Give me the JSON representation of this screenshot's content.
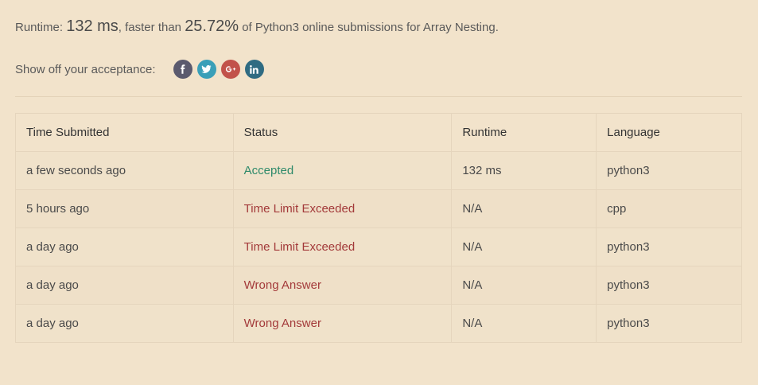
{
  "summary": {
    "runtime_prefix": "Runtime: ",
    "runtime_value": "132 ms",
    "faster_than_text": ", faster than ",
    "percentile": "25.72%",
    "suffix": " of Python3 online submissions for Array Nesting."
  },
  "share": {
    "label": "Show off your acceptance:",
    "icons": [
      {
        "name": "facebook-icon",
        "color": "#5b5a6e"
      },
      {
        "name": "twitter-icon",
        "color": "#3a9fb8"
      },
      {
        "name": "google-plus-icon",
        "color": "#c2524a"
      },
      {
        "name": "linkedin-icon",
        "color": "#2f6b82"
      }
    ]
  },
  "table": {
    "headers": [
      "Time Submitted",
      "Status",
      "Runtime",
      "Language"
    ],
    "rows": [
      {
        "time": "a few seconds ago",
        "status": "Accepted",
        "runtime": "132 ms",
        "language": "python3"
      },
      {
        "time": "5 hours ago",
        "status": "Time Limit Exceeded",
        "runtime": "N/A",
        "language": "cpp"
      },
      {
        "time": "a day ago",
        "status": "Time Limit Exceeded",
        "runtime": "N/A",
        "language": "python3"
      },
      {
        "time": "a day ago",
        "status": "Wrong Answer",
        "runtime": "N/A",
        "language": "python3"
      },
      {
        "time": "a day ago",
        "status": "Wrong Answer",
        "runtime": "N/A",
        "language": "python3"
      }
    ]
  },
  "colors": {
    "background": "#f2e3cb",
    "accepted": "#2e8a6a",
    "error": "#a33a3a"
  }
}
